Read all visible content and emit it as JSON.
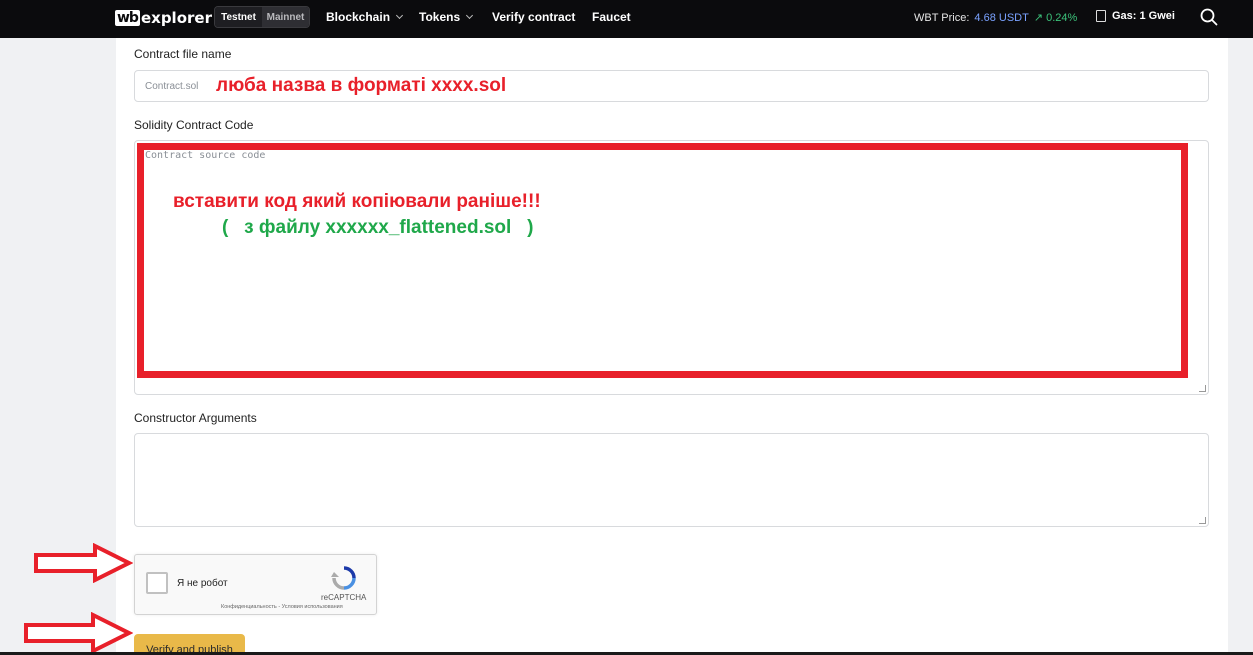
{
  "nav": {
    "logo_wb": "wb",
    "logo_text": "explorer",
    "networks": [
      "Testnet",
      "Mainnet"
    ],
    "items": [
      "Blockchain",
      "Tokens",
      "Verify contract",
      "Faucet"
    ],
    "price_label": "WBT Price:",
    "price_value": "4.68 USDT",
    "price_change": "↗ 0.24%",
    "gas": "Gas: 1 Gwei"
  },
  "form": {
    "file_label": "Contract file name",
    "file_placeholder": "Contract.sol",
    "code_label": "Solidity Contract Code",
    "code_placeholder": "Contract source code",
    "args_label": "Constructor Arguments",
    "verify_button": "Verify and publish"
  },
  "recaptcha": {
    "label": "Я не робот",
    "brand": "reCAPTCHA",
    "terms": "Конфиденциальность - Условия использования"
  },
  "annotations": {
    "file_note": "люба назва в форматі xxxx.sol",
    "code_note": "вставити код який копіювали раніше!!!",
    "code_subnote": "(   з файлу xxxxxx_flattened.sol   )"
  },
  "colors": {
    "annotation_red": "#e8202a",
    "annotation_green": "#1fa84a",
    "button_accent": "#e9b949",
    "topbar": "#0b0b0d"
  }
}
